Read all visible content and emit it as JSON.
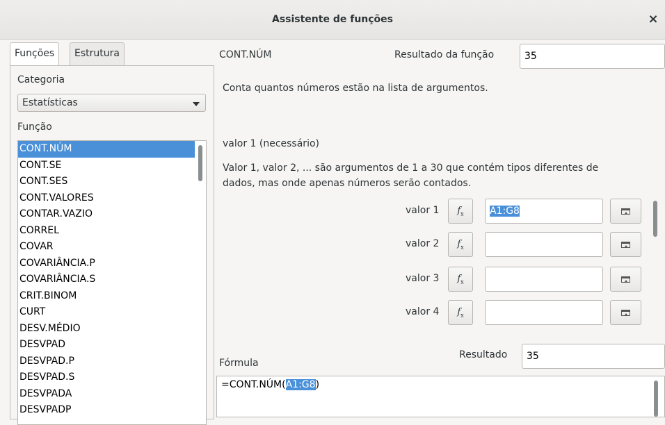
{
  "window": {
    "title": "Assistente de funções",
    "close_glyph": "×"
  },
  "tabs": [
    {
      "label": "Funções",
      "active": true
    },
    {
      "label": "Estrutura",
      "active": false
    }
  ],
  "left": {
    "category_label": "Categoria",
    "category_value": "Estatísticas",
    "function_label": "Função",
    "functions": [
      "CONT.NÚM",
      "CONT.SE",
      "CONT.SES",
      "CONT.VALORES",
      "CONTAR.VAZIO",
      "CORREL",
      "COVAR",
      "COVARIÂNCIA.P",
      "COVARIÂNCIA.S",
      "CRIT.BINOM",
      "CURT",
      "DESV.MÉDIO",
      "DESVPAD",
      "DESVPAD.P",
      "DESVPAD.S",
      "DESVPADA",
      "DESVPADP"
    ],
    "selected_index": 0
  },
  "right": {
    "function_name": "CONT.NÚM",
    "result_label": "Resultado da função",
    "result_value": "35",
    "description": "Conta quantos números estão na lista de argumentos.",
    "arg_title": "valor 1 (necessário)",
    "arg_desc_line1": "Valor 1, valor 2, ... são argumentos de 1 a 30 que contém tipos diferentes de",
    "arg_desc_line2": "dados, mas onde apenas números serão contados.",
    "args": [
      {
        "label": "valor 1",
        "value": "A1:G8"
      },
      {
        "label": "valor 2",
        "value": ""
      },
      {
        "label": "valor 3",
        "value": ""
      },
      {
        "label": "valor 4",
        "value": ""
      }
    ],
    "fx_glyph": "f",
    "fx_sub": "x",
    "formula_label": "Fórmula",
    "result2_label": "Resultado",
    "result2_value": "35",
    "formula_prefix": "=CONT.NÚM(",
    "formula_selected": "A1:G8",
    "formula_suffix": ")"
  },
  "icons": {
    "fx_button": "function-wizard-icon",
    "shrink_button": "shrink-dialog-icon",
    "dropdown": "chevron-down-icon",
    "close": "close-icon"
  }
}
